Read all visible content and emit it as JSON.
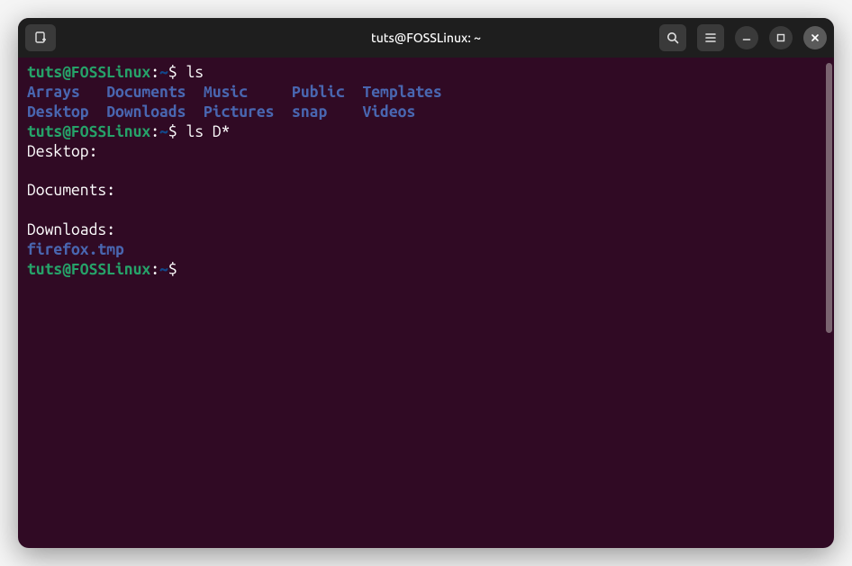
{
  "window": {
    "title": "tuts@FOSSLinux: ~"
  },
  "prompt": {
    "user_host": "tuts@FOSSLinux",
    "path": "~",
    "symbol": "$"
  },
  "commands": {
    "cmd1": "ls",
    "cmd2": "ls D*"
  },
  "ls_output": {
    "row1": {
      "c1": "Arrays",
      "c2": "Documents",
      "c3": "Music",
      "c4": "Public",
      "c5": "Templates"
    },
    "row2": {
      "c1": "Desktop",
      "c2": "Downloads",
      "c3": "Pictures",
      "c4": "snap",
      "c5": "Videos"
    }
  },
  "ls_d": {
    "header1": "Desktop:",
    "header2": "Documents:",
    "header3": "Downloads:",
    "file1": "firefox.tmp"
  },
  "spacing": {
    "col1_pad": "   ",
    "col1b_pad": "  ",
    "col2_pad": "  ",
    "col3_pad": "     ",
    "col3b_pad": "  ",
    "col4_pad": "  ",
    "col4b_pad": "    ",
    "sep": ":",
    "space": " "
  }
}
